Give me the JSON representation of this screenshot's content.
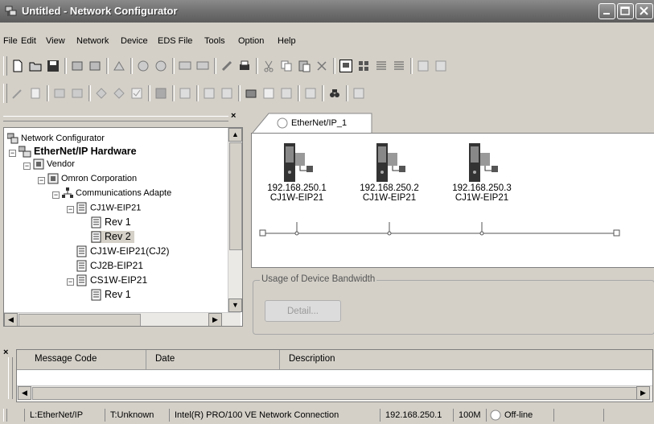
{
  "window": {
    "title": "Untitled - Network Configurator"
  },
  "menu": [
    "File",
    "Edit",
    "View",
    "Network",
    "Device",
    "EDS File",
    "Tools",
    "Option",
    "Help"
  ],
  "tree": {
    "items": [
      {
        "label": "Network Configurator"
      },
      {
        "label": "EtherNet/IP Hardware"
      },
      {
        "label": "Vendor"
      },
      {
        "label": "Omron Corporation"
      },
      {
        "label": "Communications Adapte"
      },
      {
        "label": "CJ1W-EIP21"
      },
      {
        "label": "Rev 1"
      },
      {
        "label": "Rev 2"
      },
      {
        "label": "CJ1W-EIP21(CJ2)"
      },
      {
        "label": "CJ2B-EIP21"
      },
      {
        "label": "CS1W-EIP21"
      },
      {
        "label": "Rev 1"
      }
    ]
  },
  "network": {
    "tab_label": "EtherNet/IP_1",
    "devices": [
      {
        "ip": "192.168.250.1",
        "model": "CJ1W-EIP21"
      },
      {
        "ip": "192.168.250.2",
        "model": "CJ1W-EIP21"
      },
      {
        "ip": "192.168.250.3",
        "model": "CJ1W-EIP21"
      }
    ]
  },
  "usage": {
    "legend": "Usage of Device Bandwidth",
    "detail_button": "Detail..."
  },
  "messages": {
    "columns": [
      "Message Code",
      "Date",
      "Description"
    ]
  },
  "status": {
    "cells": [
      "L:EtherNet/IP",
      "T:Unknown",
      "Intel(R) PRO/100 VE Network Connection",
      "192.168.250.1",
      "100M",
      "Off-line"
    ]
  },
  "colors": {
    "titlebar": "#6e6e6e",
    "selected": "#d4d0c8"
  }
}
